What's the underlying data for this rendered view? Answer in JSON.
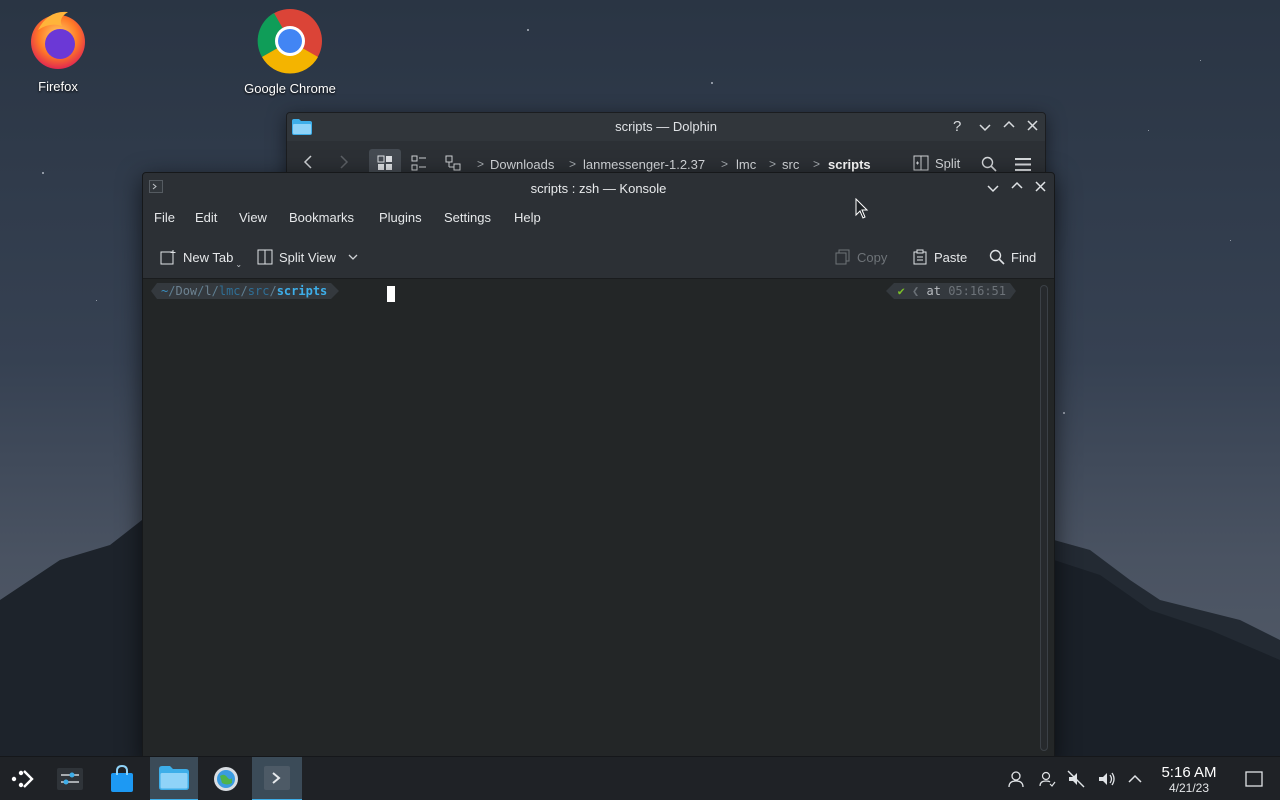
{
  "desktop": {
    "icons": [
      {
        "label": "Firefox"
      },
      {
        "label": "Google Chrome"
      }
    ]
  },
  "dolphin": {
    "title": "scripts — Dolphin",
    "breadcrumbs": [
      "Downloads",
      "lanmessenger-1.2.37",
      "lmc",
      "src",
      "scripts"
    ],
    "split_label": "Split"
  },
  "konsole": {
    "title": "scripts : zsh — Konsole",
    "menu": [
      "File",
      "Edit",
      "View",
      "Bookmarks",
      "Plugins",
      "Settings",
      "Help"
    ],
    "toolbar": {
      "new_tab": "New Tab",
      "split_view": "Split View",
      "copy": "Copy",
      "paste": "Paste",
      "find": "Find"
    },
    "prompt": {
      "home": "~",
      "dir1": "Dow",
      "dir2": "l",
      "dir3": "lmc",
      "dir4": "src",
      "current": "scripts",
      "status_check": "✔",
      "at": "at",
      "time": "05:16:51"
    }
  },
  "taskbar": {
    "clock_time": "5:16 AM",
    "clock_date": "4/21/23"
  },
  "colors": {
    "accent": "#3daee9",
    "prompt_dir": "#3a8fc0",
    "prompt_current": "#3daee9",
    "status_ok": "#7cc02a"
  }
}
